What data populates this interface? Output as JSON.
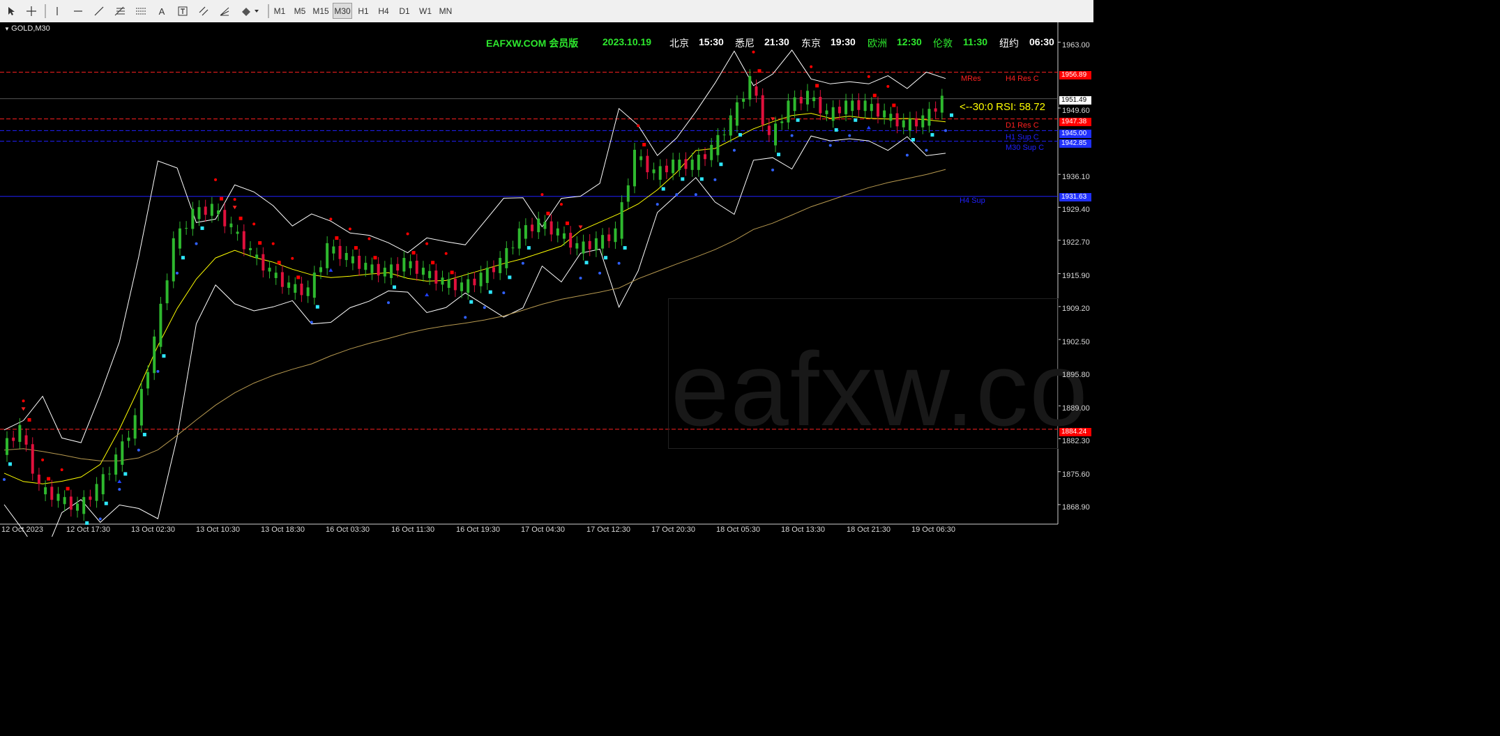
{
  "toolbar": {
    "tools": [
      {
        "name": "cursor-icon"
      },
      {
        "name": "crosshair-icon"
      },
      {
        "name": "vertical-line-icon"
      },
      {
        "name": "horizontal-line-icon"
      },
      {
        "name": "trendline-icon"
      },
      {
        "name": "fibonacci-icon"
      },
      {
        "name": "fibo-grid-icon"
      },
      {
        "name": "text-icon"
      },
      {
        "name": "text-label-icon"
      },
      {
        "name": "channel-icon"
      },
      {
        "name": "fibo-fan-icon"
      },
      {
        "name": "shapes-icon"
      }
    ],
    "text_tool_label": "A",
    "timeframes": [
      "M1",
      "M5",
      "M15",
      "M30",
      "H1",
      "H4",
      "D1",
      "W1",
      "MN"
    ],
    "active_timeframe": "M30"
  },
  "chart": {
    "symbol": "GOLD,M30",
    "header": {
      "site": "EAFXW.COM 会员版",
      "date": "2023.10.19",
      "clocks": [
        {
          "city": "北京",
          "time": "15:30",
          "color": "#ffffff"
        },
        {
          "city": "悉尼",
          "time": "21:30",
          "color": "#ffffff"
        },
        {
          "city": "东京",
          "time": "19:30",
          "color": "#ffffff"
        },
        {
          "city": "欧洲",
          "time": "12:30",
          "color": "#2ee82e"
        },
        {
          "city": "伦敦",
          "time": "11:30",
          "color": "#2ee82e"
        },
        {
          "city": "纽约",
          "time": "06:30",
          "color": "#ffffff"
        }
      ]
    },
    "rsi_text": "<--30:0  RSI: 58.72",
    "watermark": "eafxw.co",
    "price_labels": [
      "1963.00",
      "1949.60",
      "1936.10",
      "1929.40",
      "1922.70",
      "1915.90",
      "1909.20",
      "1902.50",
      "1895.80",
      "1889.00",
      "1882.30",
      "1875.60",
      "1868.90"
    ],
    "current_price": "1951.49",
    "levels": [
      {
        "price": 1956.89,
        "tag": "1956.89",
        "label": "MRes",
        "label2": "H4 Res C",
        "color": "#ff2020",
        "tag_bg": "#ff0000"
      },
      {
        "price": 1947.38,
        "tag": "1947.38",
        "label": "D1 Res C",
        "color": "#ff2020",
        "tag_bg": "#ff0000"
      },
      {
        "price": 1945.0,
        "tag": "1945.00",
        "label": "H1 Sup C",
        "color": "#2020ff",
        "tag_bg": "#2030ff"
      },
      {
        "price": 1942.85,
        "tag": "1942.85",
        "label": "M30 Sup C",
        "color": "#2020ff",
        "tag_bg": "#2030ff"
      },
      {
        "price": 1931.63,
        "tag": "1931.63",
        "label": "H4 Sup",
        "color": "#2020ff",
        "tag_bg": "#2030ff"
      },
      {
        "price": 1884.24,
        "tag": "1884.24",
        "label": "",
        "color": "#ff2020",
        "tag_bg": "#ff0000"
      }
    ],
    "time_labels": [
      "12 Oct 2023",
      "12 Oct 17:30",
      "13 Oct 02:30",
      "13 Oct 10:30",
      "13 Oct 18:30",
      "16 Oct 03:30",
      "16 Oct 11:30",
      "16 Oct 19:30",
      "17 Oct 04:30",
      "17 Oct 12:30",
      "17 Oct 20:30",
      "18 Oct 05:30",
      "18 Oct 13:30",
      "18 Oct 21:30",
      "19 Oct 06:30"
    ]
  },
  "chart_data": {
    "type": "candlestick",
    "symbol": "GOLD",
    "timeframe": "M30",
    "ylim": [
      1866.0,
      1966.0
    ],
    "price_series": [
      1880,
      1884,
      1872,
      1870,
      1868,
      1872,
      1878,
      1886,
      1902,
      1922,
      1928,
      1929,
      1925,
      1920,
      1916,
      1913,
      1912,
      1921,
      1919,
      1917,
      1916,
      1918,
      1916,
      1914,
      1913,
      1915,
      1918,
      1924,
      1926,
      1924,
      1921,
      1922,
      1924,
      1940,
      1936,
      1938,
      1938,
      1941,
      1947,
      1955,
      1943,
      1950,
      1952,
      1948,
      1950,
      1950,
      1948,
      1946,
      1947,
      1951
    ],
    "colors": {
      "bull": "#2eb82e",
      "bear": "#e0103c",
      "ma": "#ffff00",
      "bands": "#ffffff",
      "trail_up": "#2ee8ff",
      "trail_down": "#ff0000",
      "sar": "#3060ff"
    }
  }
}
